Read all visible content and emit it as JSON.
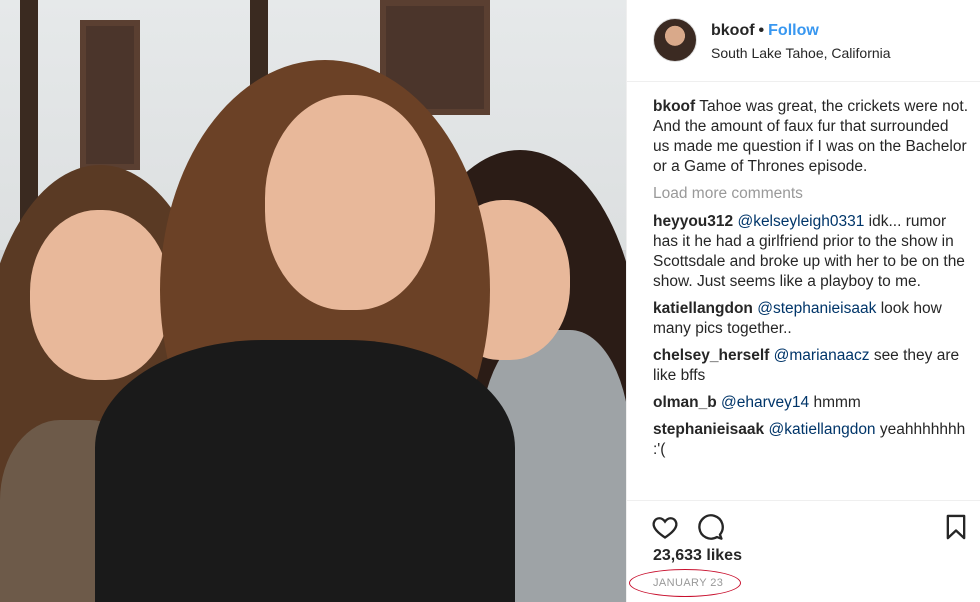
{
  "post": {
    "username": "bkoof",
    "follow_label": "Follow",
    "dot": "•",
    "location": "South Lake Tahoe, California",
    "caption": {
      "author": "bkoof",
      "text": "Tahoe was great, the crickets were not. And the amount of faux fur that surrounded us made me question if I was on the Bachelor or a Game of Thrones episode."
    },
    "load_more_label": "Load more comments",
    "comments": [
      {
        "author": "heyyou312",
        "mention": "@kelseyleigh0331",
        "text": "idk... rumor has it he had a girlfriend prior to the show in Scottsdale and broke up with her to be on the show. Just seems like a playboy to me."
      },
      {
        "author": "katiellangdon",
        "mention": "@stephanieisaak",
        "text": "look how many pics together.."
      },
      {
        "author": "chelsey_herself",
        "mention": "@marianaacz",
        "text": "see they are like bffs"
      },
      {
        "author": "olman_b",
        "mention": "@eharvey14",
        "text": "hmmm"
      },
      {
        "author": "stephanieisaak",
        "mention": "@katiellangdon",
        "text": "yeahhhhhhh :'("
      }
    ],
    "likes": "23,633 likes",
    "date": "JANUARY 23"
  },
  "icons": [
    "heart-icon",
    "comment-icon",
    "bookmark-icon"
  ],
  "colors": {
    "link": "#3897f0",
    "mention": "#003569",
    "annotation": "#c8102e",
    "muted": "#999999"
  }
}
